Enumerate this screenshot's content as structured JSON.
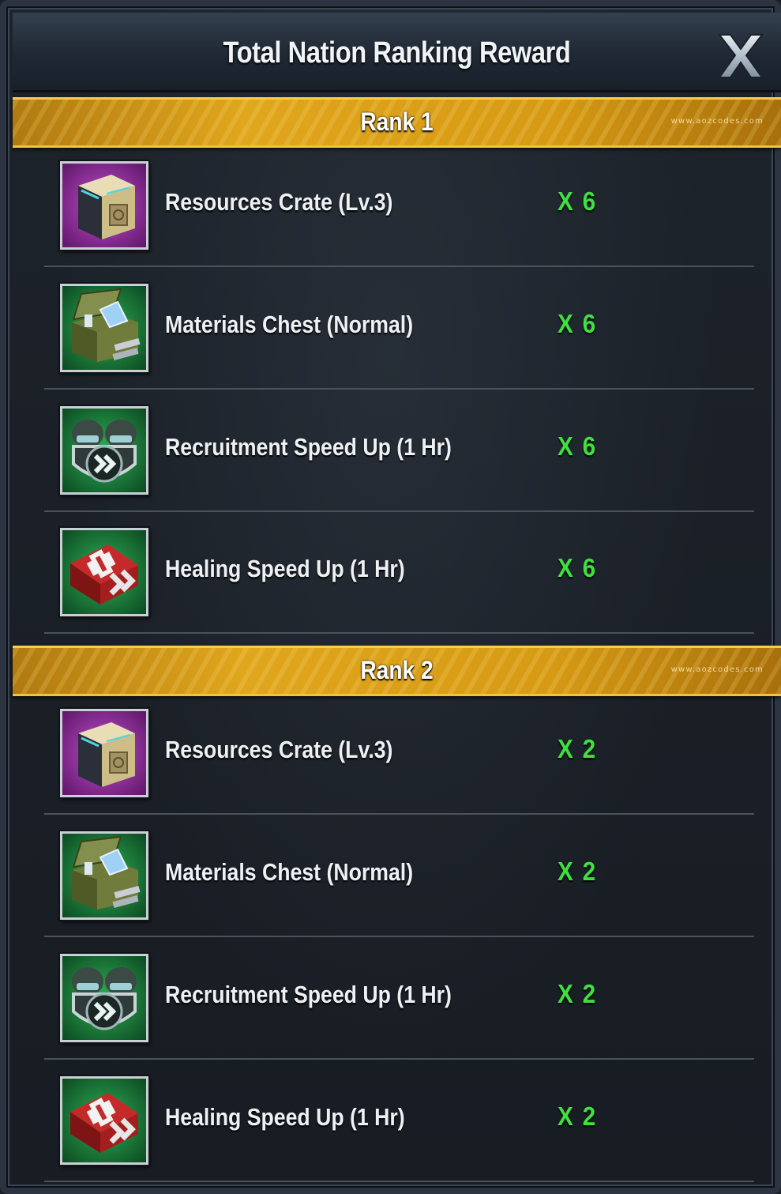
{
  "dialog": {
    "title": "Total Nation Ranking Reward"
  },
  "icons": {
    "close": "close-x-icon",
    "resources_crate": "resources-crate-icon",
    "materials_chest": "materials-chest-icon",
    "recruitment_speed_up": "recruitment-speed-up-icon",
    "healing_speed_up": "healing-speed-up-icon"
  },
  "colors": {
    "quantity": "#3fe13f",
    "rank_bar": "#e0a61c",
    "rare_purple": "#9b2fa8",
    "common_green": "#1f8a3c"
  },
  "watermark": "www.aozcodes.com",
  "ranks": [
    {
      "label": "Rank 1",
      "rewards": [
        {
          "name": "Resources Crate (Lv.3)",
          "qty": "X 6"
        },
        {
          "name": "Materials Chest (Normal)",
          "qty": "X 6"
        },
        {
          "name": "Recruitment Speed Up (1 Hr)",
          "qty": "X 6"
        },
        {
          "name": "Healing Speed Up (1 Hr)",
          "qty": "X 6"
        }
      ]
    },
    {
      "label": "Rank 2",
      "rewards": [
        {
          "name": "Resources Crate (Lv.3)",
          "qty": "X 2"
        },
        {
          "name": "Materials Chest (Normal)",
          "qty": "X 2"
        },
        {
          "name": "Recruitment Speed Up (1 Hr)",
          "qty": "X 2"
        },
        {
          "name": "Healing Speed Up (1 Hr)",
          "qty": "X 2"
        }
      ]
    }
  ]
}
